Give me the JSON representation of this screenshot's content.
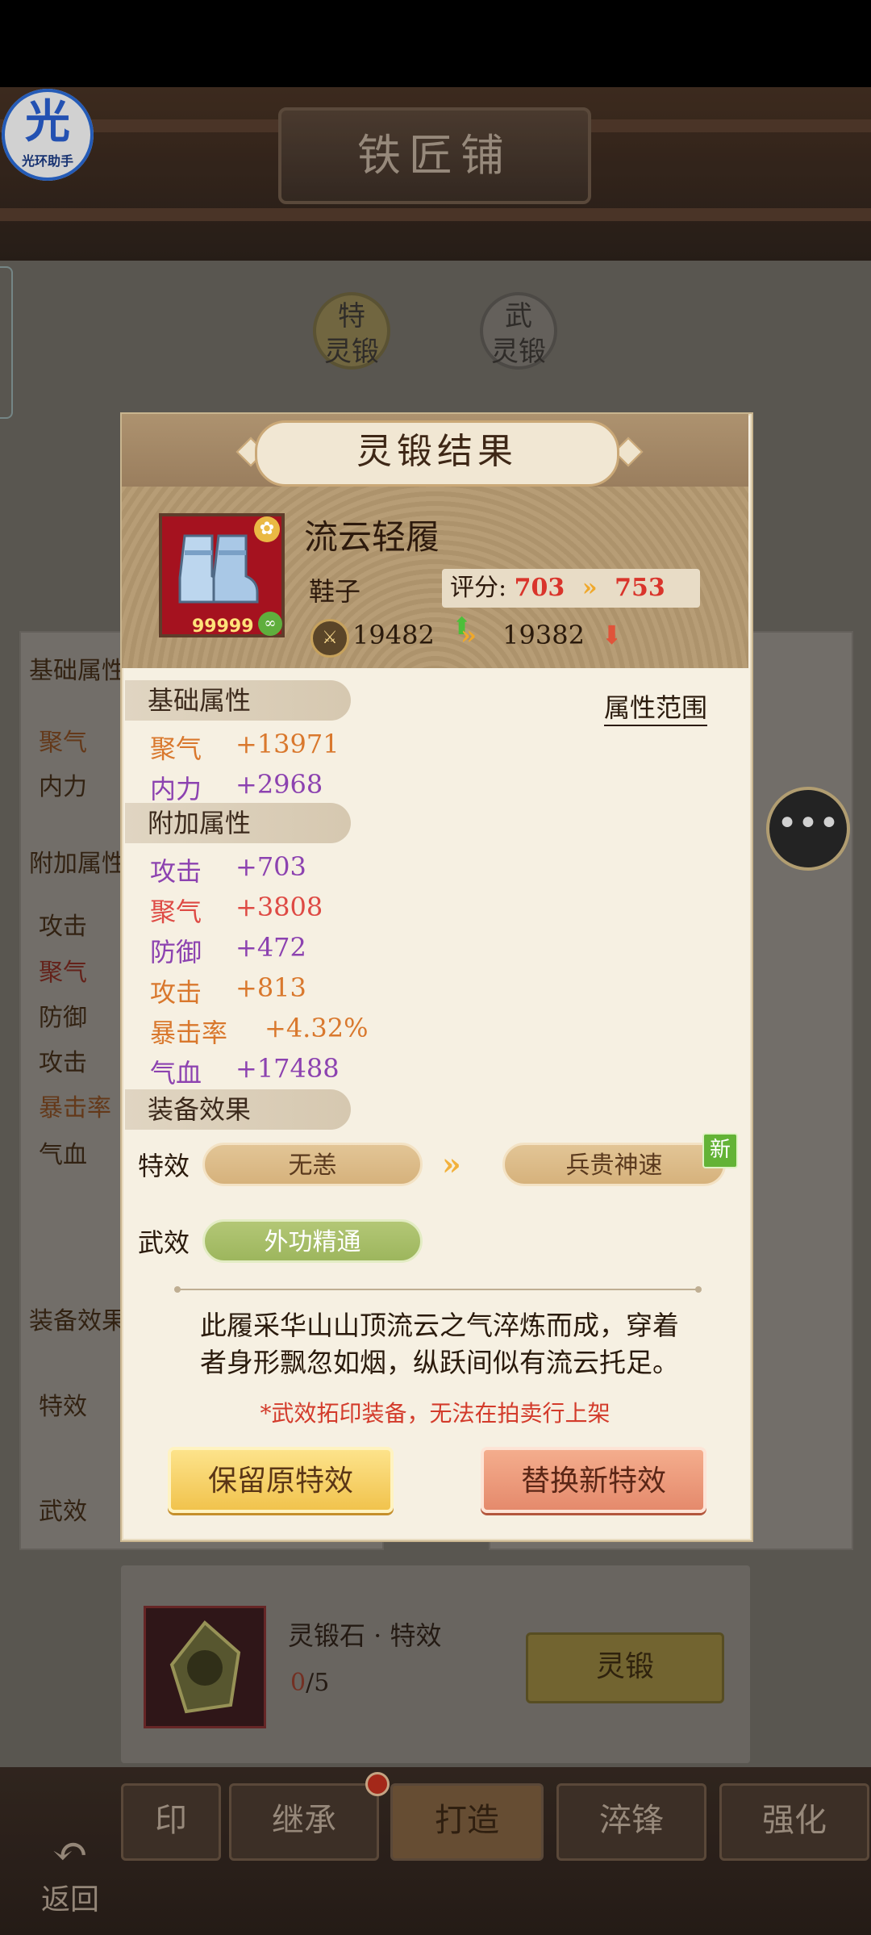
{
  "screen": {
    "title": "铁匠铺",
    "helper": {
      "big": "光",
      "small": "光环助手"
    },
    "top_icons": [
      {
        "top": "特",
        "bottom": "灵锻"
      },
      {
        "top": "武",
        "bottom": "灵锻"
      }
    ],
    "bg_left": {
      "basic_header": "基础属性",
      "basic_items": [
        "聚气",
        "内力"
      ],
      "extra_header": "附加属性",
      "extra_items": [
        "攻击",
        "聚气",
        "防御",
        "攻击",
        "暴击率",
        "气血"
      ],
      "effect_header": "装备效果",
      "effect_items": [
        "特效",
        "武效"
      ]
    },
    "stone": {
      "name": "灵锻石 · 特效",
      "count_have": "0",
      "count_need": "/5",
      "button": "灵锻"
    },
    "bottom_tabs": [
      "印",
      "继承",
      "打造",
      "淬锋",
      "强化"
    ],
    "back_label": "返回"
  },
  "dialog": {
    "title": "灵锻结果",
    "item": {
      "name": "流云轻履",
      "type": "鞋子",
      "quantity": "99999",
      "score_label": "评分:",
      "score_old": "703",
      "score_new": "753",
      "power_old": "19482",
      "power_new": "19382"
    },
    "range_link": "属性范围",
    "basic_header": "基础属性",
    "basic_attrs": [
      {
        "name": "聚气",
        "value": "+13971"
      },
      {
        "name": "内力",
        "value": "+2968"
      }
    ],
    "extra_header": "附加属性",
    "extra_attrs": [
      {
        "name": "攻击",
        "value": "+703"
      },
      {
        "name": "聚气",
        "value": "+3808"
      },
      {
        "name": "防御",
        "value": "+472"
      },
      {
        "name": "攻击",
        "value": "+813"
      },
      {
        "name": "暴击率",
        "value": "+4.32%"
      },
      {
        "name": "气血",
        "value": "+17488"
      }
    ],
    "effect_header": "装备效果",
    "special_label": "特效",
    "special_old": "无恙",
    "special_new": "兵贵神速",
    "new_badge": "新",
    "martial_label": "武效",
    "martial_value": "外功精通",
    "description_line1": "此履采华山山顶流云之气淬炼而成，穿着",
    "description_line2": "者身形飘忽如烟，纵跃间似有流云托足。",
    "warning": "*武效拓印装备，无法在拍卖行上架",
    "keep_button": "保留原特效",
    "replace_button": "替换新特效"
  },
  "colors": {
    "score_red": "#d9342b",
    "score_up": "#4cbf3a",
    "orange_attr": "#d9782d",
    "purple_attr": "#8c42b0"
  }
}
